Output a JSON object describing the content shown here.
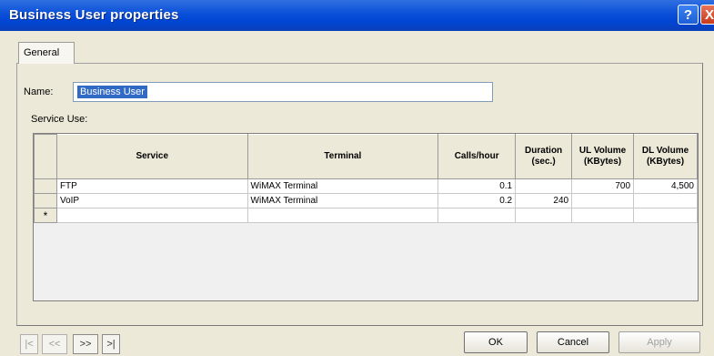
{
  "window": {
    "title": "Business User properties"
  },
  "title_buttons": {
    "help": "?",
    "close": "X"
  },
  "tabs": [
    {
      "label": "General"
    }
  ],
  "name_field": {
    "label": "Name:",
    "value": "Business User"
  },
  "service_users_label": "Service Use:",
  "table": {
    "columns": [
      "Service",
      "Terminal",
      "Calls/hour",
      "Duration (sec.)",
      "UL Volume (KBytes)",
      "DL Volume (KBytes)"
    ],
    "rows": [
      {
        "service": "FTP",
        "terminal": "WiMAX Terminal",
        "calls_hour": "0.1",
        "duration": "",
        "ul_volume": "700",
        "dl_volume": "4,500"
      },
      {
        "service": "VoIP",
        "terminal": "WiMAX Terminal",
        "calls_hour": "0.2",
        "duration": "240",
        "ul_volume": "",
        "dl_volume": ""
      }
    ],
    "new_row_marker": "*"
  },
  "nav": {
    "first": "|<",
    "prev": "<<",
    "next": ">>",
    "last": ">|"
  },
  "buttons": {
    "ok": "OK",
    "cancel": "Cancel",
    "apply": "Apply"
  }
}
